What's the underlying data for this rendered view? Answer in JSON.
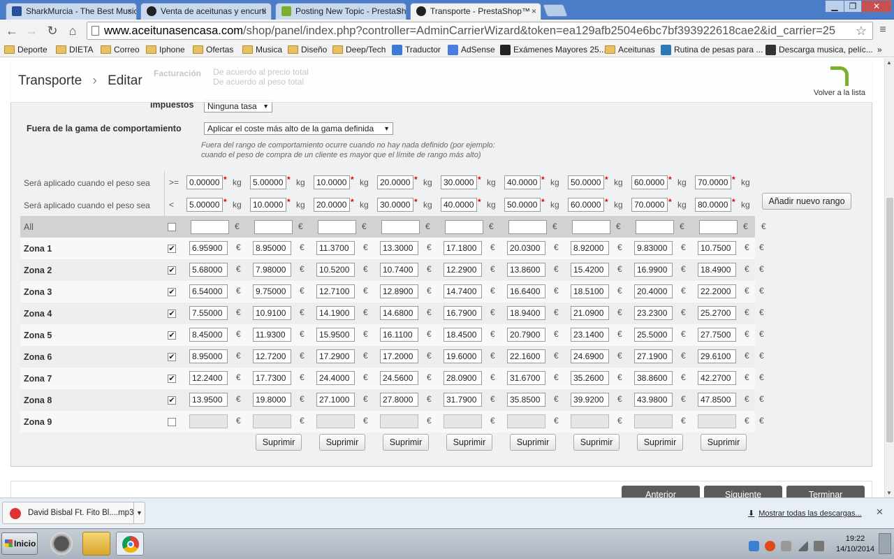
{
  "browser": {
    "tabs": [
      {
        "title": "SharkMurcia - The Best Music",
        "active": false
      },
      {
        "title": "Venta de aceitunas y encurti",
        "active": false
      },
      {
        "title": "Posting New Topic - PrestaSh",
        "active": false
      },
      {
        "title": "Transporte - PrestaShop™",
        "active": true
      }
    ],
    "close_glyph": "×",
    "url_domain": "www.aceitunasencasa.com",
    "url_rest": "/shop/panel/index.php?controller=AdminCarrierWizard&token=ea129afb2504e6bc7bf393922618cae2&id_carrier=25",
    "bookmarks": [
      "Deporte",
      "DIETA",
      "Correo",
      "Iphone",
      "Ofertas",
      "Musica",
      "Diseño",
      "Deep/Tech",
      "Traductor",
      "AdSense",
      "Exámenes Mayores 25...",
      "Aceitunas",
      "Rutina de pesas para ...",
      "Descarga musica, pelíc..."
    ],
    "overflow_glyph": "»"
  },
  "header": {
    "breadcrumb_section": "Transporte",
    "breadcrumb_sep": "›",
    "breadcrumb_current": "Editar",
    "back_label": "Volver a la lista",
    "ghost_label": "Facturación",
    "ghost_opt1": "De acuerdo al precio total",
    "ghost_opt2": "De acuerdo al peso total"
  },
  "form": {
    "tax_label": "Impuestos",
    "tax_value": "Ninguna tasa",
    "oor_label": "Fuera de la gama de comportamiento",
    "oor_value": "Aplicar el coste más alto de la gama definida",
    "oor_help_1": "Fuera del rango de comportamiento ocurre cuando no hay nada definido (por ejemplo:",
    "oor_help_2": "cuando el peso de compra de un cliente es mayor que el límite de rango más alto)",
    "add_range": "Añadir nuevo rango"
  },
  "ranges": {
    "label": "Será aplicado cuando el peso sea",
    "op_ge": ">=",
    "op_lt": "<",
    "unit": "kg",
    "required_mark": "*",
    "from": [
      "0.00000",
      "5.00000",
      "10.0000",
      "20.0000",
      "30.0000",
      "40.0000",
      "50.0000",
      "60.0000",
      "70.0000"
    ],
    "to": [
      "5.00000",
      "10.0000",
      "20.0000",
      "30.0000",
      "40.0000",
      "50.0000",
      "60.0000",
      "70.0000",
      "80.0000"
    ]
  },
  "zones": {
    "currency": "€",
    "all_label": "All",
    "rows": [
      {
        "name": "Zona 1",
        "checked": true,
        "prices": [
          "6.95900",
          "8.95000",
          "11.3700",
          "13.3000",
          "17.1800",
          "20.0300",
          "8.92000",
          "9.83000",
          "10.7500"
        ]
      },
      {
        "name": "Zona 2",
        "checked": true,
        "prices": [
          "5.68000",
          "7.98000",
          "10.5200",
          "10.7400",
          "12.2900",
          "13.8600",
          "15.4200",
          "16.9900",
          "18.4900"
        ]
      },
      {
        "name": "Zona 3",
        "checked": true,
        "prices": [
          "6.54000",
          "9.75000",
          "12.7100",
          "12.8900",
          "14.7400",
          "16.6400",
          "18.5100",
          "20.4000",
          "22.2000"
        ]
      },
      {
        "name": "Zona 4",
        "checked": true,
        "prices": [
          "7.55000",
          "10.9100",
          "14.1900",
          "14.6800",
          "16.7900",
          "18.9400",
          "21.0900",
          "23.2300",
          "25.2700"
        ]
      },
      {
        "name": "Zona 5",
        "checked": true,
        "prices": [
          "8.45000",
          "11.9300",
          "15.9500",
          "16.1100",
          "18.4500",
          "20.7900",
          "23.1400",
          "25.5000",
          "27.7500"
        ]
      },
      {
        "name": "Zona 6",
        "checked": true,
        "prices": [
          "8.95000",
          "12.7200",
          "17.2900",
          "17.2000",
          "19.6000",
          "22.1600",
          "24.6900",
          "27.1900",
          "29.6100"
        ]
      },
      {
        "name": "Zona 7",
        "checked": true,
        "prices": [
          "12.2400",
          "17.7300",
          "24.4000",
          "24.5600",
          "28.0900",
          "31.6700",
          "35.2600",
          "38.8600",
          "42.2700"
        ]
      },
      {
        "name": "Zona 8",
        "checked": true,
        "prices": [
          "13.9500",
          "19.8000",
          "27.1000",
          "27.8000",
          "31.7900",
          "35.8500",
          "39.9200",
          "43.9800",
          "47.8500"
        ]
      },
      {
        "name": "Zona 9",
        "checked": false,
        "prices": [
          "",
          "",
          "",
          "",
          "",
          "",
          "",
          "",
          ""
        ]
      }
    ],
    "delete_label": "Suprimir"
  },
  "footer": {
    "prev": "Anterior",
    "next": "Siguiente",
    "finish": "Terminar"
  },
  "downloads": {
    "file": "David Bisbal Ft. Fito Bl....mp3",
    "show_all": "Mostrar todas las descargas...",
    "close_glyph": "✕"
  },
  "taskbar": {
    "start": "Inicio",
    "time": "19:22",
    "date": "14/10/2014"
  },
  "colors": {
    "tabbar": "#4a7cc7",
    "panel_bg": "#eff1f2",
    "header_row": "#d2d2d2",
    "required": "#ee0000",
    "back_arrow": "#7bb02f",
    "footer_button": "#5b5b5b"
  }
}
